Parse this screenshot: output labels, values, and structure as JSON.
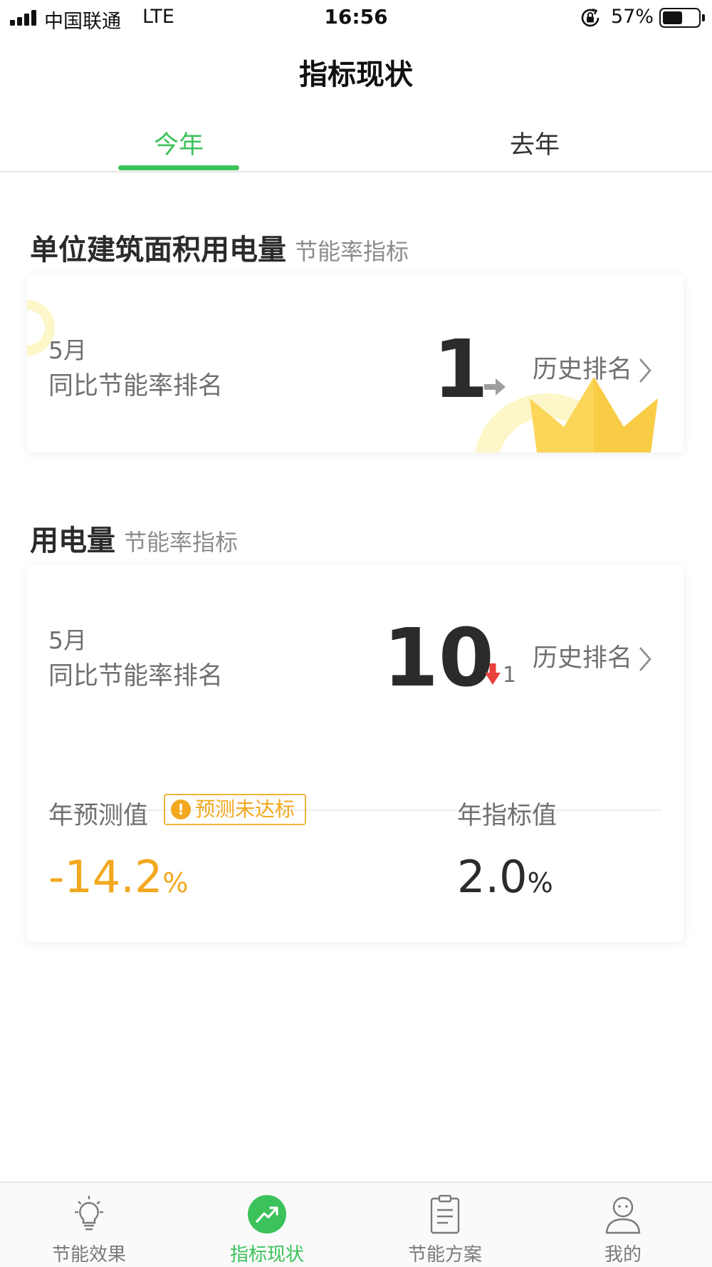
{
  "status_bar": {
    "carrier": "中国联通",
    "network": "LTE",
    "time": "16:56",
    "battery_percent": "57%",
    "battery_level": 0.57
  },
  "page_title": "指标现状",
  "tabs": [
    {
      "label": "今年",
      "active": true
    },
    {
      "label": "去年",
      "active": false
    }
  ],
  "section1": {
    "title": "单位建筑面积用电量",
    "subtitle": "节能率指标",
    "card": {
      "month": "5月",
      "rank_label": "同比节能率排名",
      "rank": "1",
      "trend_icon": "arrow-right-icon",
      "history_label": "历史排名",
      "decoration_icon": "crown-icon"
    }
  },
  "section2": {
    "title": "用电量",
    "subtitle": "节能率指标",
    "card": {
      "month": "5月",
      "rank_label": "同比节能率排名",
      "rank": "10",
      "trend_icon": "arrow-down-icon",
      "trend_change": "1",
      "history_label": "历史排名",
      "forecast_label": "年预测值",
      "warning_badge": "预测未达标",
      "forecast_value": "-14.2",
      "forecast_unit": "%",
      "target_label": "年指标值",
      "target_value": "2.0",
      "target_unit": "%"
    }
  },
  "bottom_nav": [
    {
      "label": "节能效果",
      "icon": "lightbulb-icon",
      "active": false
    },
    {
      "label": "指标现状",
      "icon": "trend-chart-icon",
      "active": true
    },
    {
      "label": "节能方案",
      "icon": "clipboard-icon",
      "active": false
    },
    {
      "label": "我的",
      "icon": "user-icon",
      "active": false
    }
  ],
  "colors": {
    "accent_green": "#3cc25a",
    "warning_orange": "#f2a81f",
    "down_red": "#e8413c",
    "crown_yellow": "#fcd659"
  }
}
